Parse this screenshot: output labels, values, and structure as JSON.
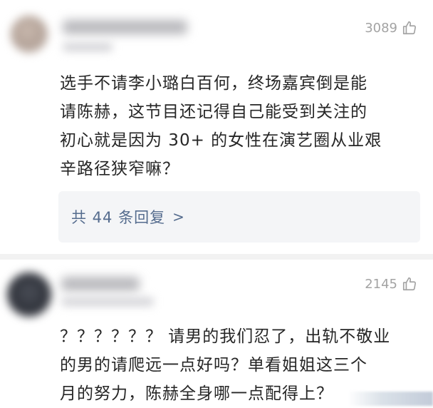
{
  "comments": [
    {
      "likes": "3089",
      "text": "选手不请李小璐白百何，终场嘉宾倒是能\n请陈赫，这节目还记得自己能受到关注的\n初心就是因为 30+ 的女性在演艺圈从业艰\n辛路径狭窄嘛？",
      "replies_label": "共 44 条回复",
      "replies_chevron": ">",
      "avatar_icon": "avatar-blurred",
      "like_icon": "thumbs-up-outline-icon"
    },
    {
      "likes": "2145",
      "text": "？？？？？？ 请男的我们忍了，出轨不敬业\n的男的请爬远一点好吗？单看姐姐这三个\n月的努力，陈赫全身哪一点配得上？",
      "avatar_icon": "avatar-blurred",
      "like_icon": "thumbs-up-outline-icon"
    }
  ],
  "colors": {
    "text": "#262626",
    "muted": "#a3a3a3",
    "reply_link": "#556c8e",
    "reply_bg": "#f4f5f7"
  }
}
